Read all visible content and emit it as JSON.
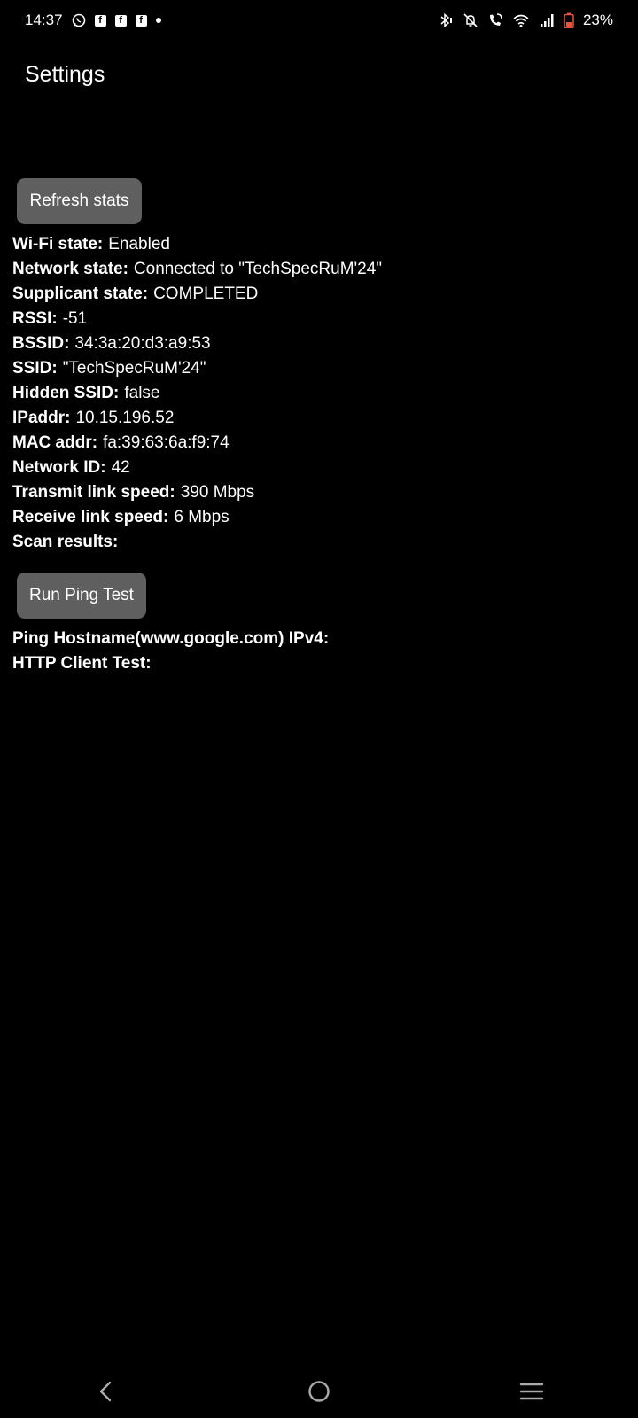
{
  "status_bar": {
    "time": "14:37",
    "battery_percent": "23%",
    "left_icons": [
      "whatsapp-icon",
      "facebook-icon",
      "facebook-icon",
      "facebook-icon",
      "dot-icon"
    ],
    "right_icons": [
      "bluetooth-icon",
      "mute-icon",
      "wifi-calling-icon",
      "wifi-icon",
      "signal-icon",
      "battery-icon"
    ],
    "battery_color": "#e8523c"
  },
  "header": {
    "title": "Settings"
  },
  "buttons": {
    "refresh_label": "Refresh stats",
    "ping_label": "Run Ping Test",
    "color": "#5f5f5f"
  },
  "stats": [
    {
      "key": "Wi-Fi state:",
      "value": "Enabled"
    },
    {
      "key": "Network state:",
      "value": "Connected to \"TechSpecRuM'24\""
    },
    {
      "key": "Supplicant state:",
      "value": "COMPLETED"
    },
    {
      "key": "RSSI:",
      "value": "-51"
    },
    {
      "key": "BSSID:",
      "value": "34:3a:20:d3:a9:53"
    },
    {
      "key": "SSID:",
      "value": "\"TechSpecRuM'24\""
    },
    {
      "key": "Hidden SSID:",
      "value": "false"
    },
    {
      "key": "IPaddr:",
      "value": "10.15.196.52"
    },
    {
      "key": "MAC addr:",
      "value": "fa:39:63:6a:f9:74"
    },
    {
      "key": "Network ID:",
      "value": "42"
    },
    {
      "key": "Transmit link speed:",
      "value": "390 Mbps"
    },
    {
      "key": "Receive link speed:",
      "value": "6 Mbps"
    },
    {
      "key": "Scan results:",
      "value": ""
    }
  ],
  "tests": [
    {
      "key": "Ping Hostname(www.google.com) IPv4:",
      "value": ""
    },
    {
      "key": "HTTP Client Test:",
      "value": ""
    }
  ],
  "nav": [
    "back-icon",
    "home-icon",
    "recents-icon"
  ]
}
